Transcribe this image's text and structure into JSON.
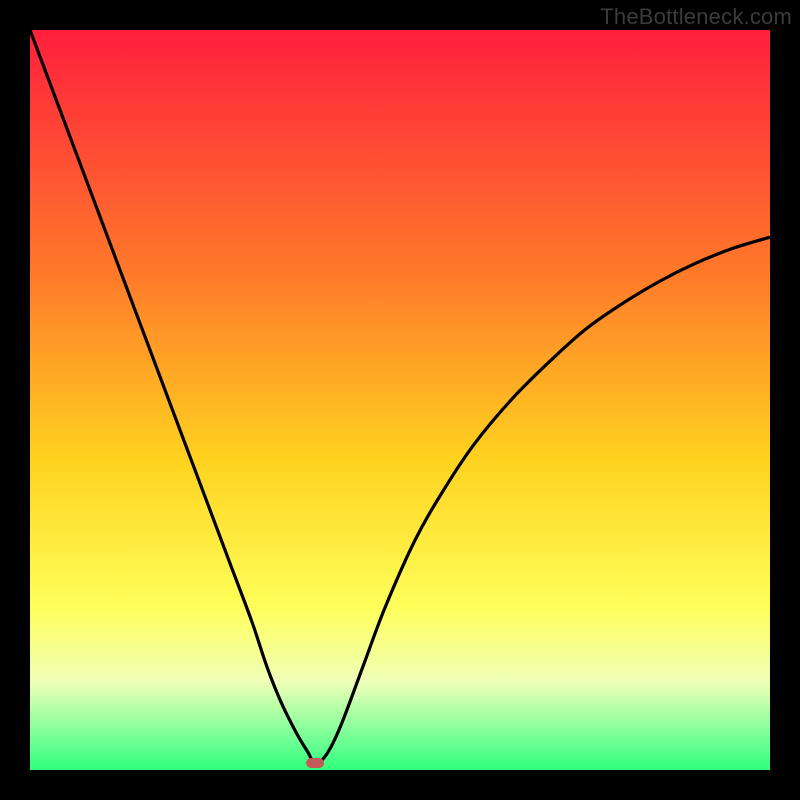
{
  "watermark": "TheBottleneck.com",
  "colors": {
    "black": "#000000",
    "gradient_top": "#ff1f3d",
    "gradient_mid1": "#ff6a2a",
    "gradient_mid2": "#ffb81f",
    "gradient_mid3": "#ffe91f",
    "gradient_mid4": "#f7ffb0",
    "gradient_bottom": "#2eff7a",
    "curve": "#000000",
    "marker": "#c25a5a"
  },
  "chart_data": {
    "type": "line",
    "title": "",
    "xlabel": "",
    "ylabel": "",
    "xlim": [
      0,
      100
    ],
    "ylim": [
      0,
      100
    ],
    "gradient_stops": [
      {
        "pos": 0.0,
        "color": "#ff1f3d"
      },
      {
        "pos": 0.33,
        "color": "#ff7a2a"
      },
      {
        "pos": 0.58,
        "color": "#ffd21f"
      },
      {
        "pos": 0.78,
        "color": "#ffff5a"
      },
      {
        "pos": 0.88,
        "color": "#f0ffb8"
      },
      {
        "pos": 0.97,
        "color": "#60ff8f"
      },
      {
        "pos": 1.0,
        "color": "#2eff7a"
      }
    ],
    "series": [
      {
        "name": "bottleneck-curve",
        "x": [
          0,
          3,
          6,
          9,
          12,
          15,
          18,
          21,
          24,
          27,
          30,
          32,
          34,
          36,
          37.5,
          38.5,
          40,
          42,
          45,
          48,
          52,
          56,
          60,
          65,
          70,
          75,
          80,
          85,
          90,
          95,
          100
        ],
        "y": [
          100,
          92,
          84,
          76,
          68,
          60,
          52,
          44,
          36,
          28,
          20,
          14,
          9,
          5,
          2.5,
          1,
          2,
          6,
          14,
          22,
          31,
          38,
          44,
          50,
          55,
          59.5,
          63,
          66,
          68.5,
          70.5,
          72
        ]
      }
    ],
    "marker": {
      "x": 38.5,
      "y": 1,
      "label": "optimal-point"
    }
  }
}
